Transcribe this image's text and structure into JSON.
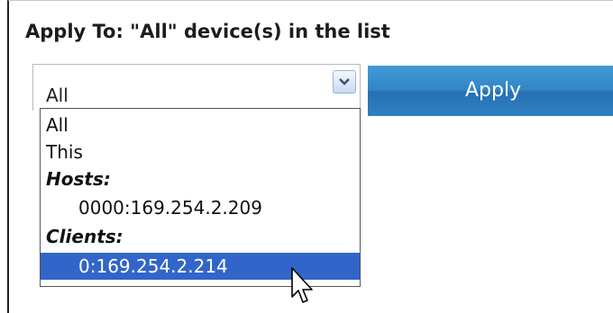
{
  "apply_to": {
    "heading": "Apply To: \"All\" device(s) in the list",
    "select": {
      "value": "All"
    },
    "button_label": "Apply"
  },
  "dropdown": {
    "options": [
      {
        "label": "All",
        "kind": "option"
      },
      {
        "label": "This",
        "kind": "option"
      },
      {
        "label": "Hosts:",
        "kind": "group"
      },
      {
        "label": "0000:169.254.2.209",
        "kind": "option"
      },
      {
        "label": "Clients:",
        "kind": "group"
      },
      {
        "label": "0:169.254.2.214",
        "kind": "option",
        "selected": true
      }
    ]
  },
  "colors": {
    "button_blue": "#3386c6",
    "selection_blue": "#3165c9"
  },
  "icons": {
    "select_arrow": "chevron-down-icon",
    "cursor": "mouse-pointer-icon"
  }
}
